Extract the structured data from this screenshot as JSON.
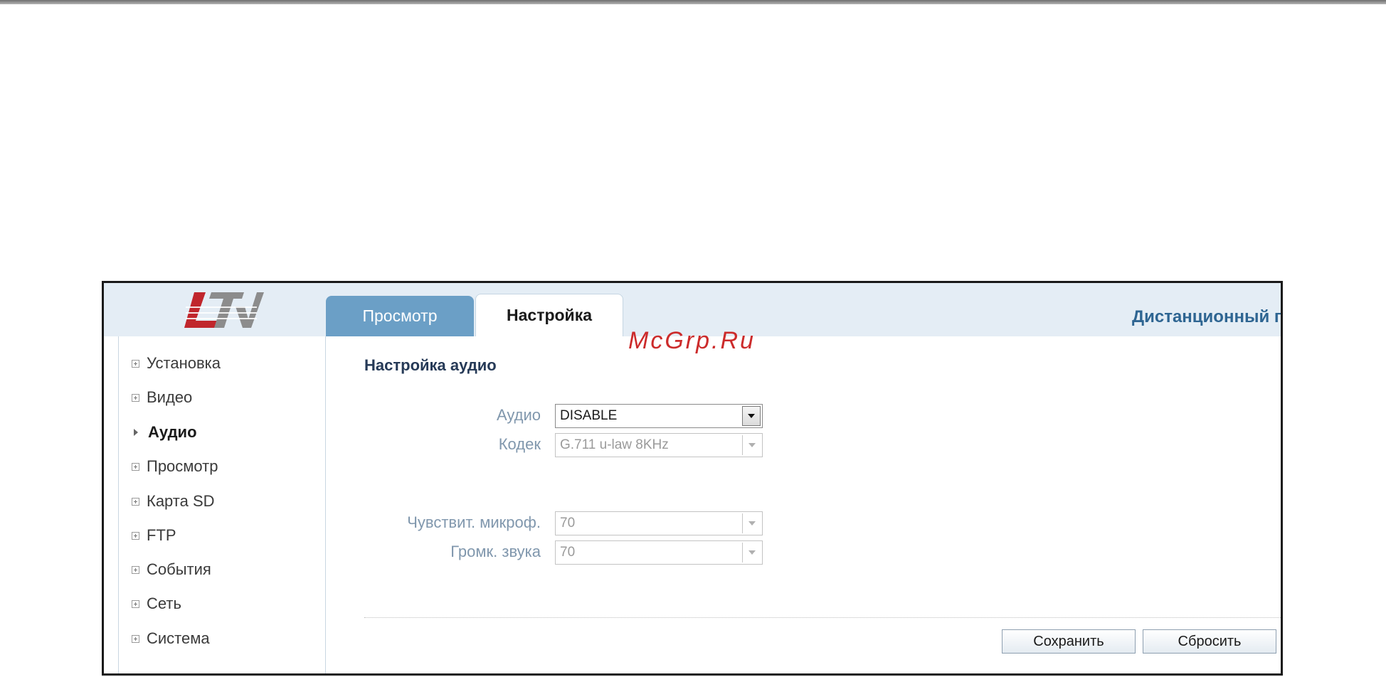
{
  "brand": {
    "logo_text": "LTV",
    "logo_color": "#c0262c"
  },
  "header": {
    "tabs": [
      {
        "label": "Просмотр",
        "active": false
      },
      {
        "label": "Настройка",
        "active": true
      }
    ],
    "title": "Дистанционный г"
  },
  "sidebar": {
    "items": [
      {
        "label": "Установка",
        "icon": "plus-box-icon",
        "active": false
      },
      {
        "label": "Видео",
        "icon": "plus-box-icon",
        "active": false
      },
      {
        "label": "Аудио",
        "icon": "arrow-right-icon",
        "active": true
      },
      {
        "label": "Просмотр",
        "icon": "plus-box-icon",
        "active": false
      },
      {
        "label": "Карта SD",
        "icon": "plus-box-icon",
        "active": false
      },
      {
        "label": "FTP",
        "icon": "plus-box-icon",
        "active": false
      },
      {
        "label": "События",
        "icon": "plus-box-icon",
        "active": false
      },
      {
        "label": "Сеть",
        "icon": "plus-box-icon",
        "active": false
      },
      {
        "label": "Система",
        "icon": "plus-box-icon",
        "active": false
      }
    ]
  },
  "main": {
    "section_title": "Настройка аудио",
    "fields": {
      "audio": {
        "label": "Аудио",
        "value": "DISABLE",
        "enabled": true
      },
      "codec": {
        "label": "Кодек",
        "value": "G.711 u-law 8KHz",
        "enabled": false
      },
      "mic_sensitivity": {
        "label": "Чувствит. микроф.",
        "value": "70",
        "enabled": false
      },
      "volume": {
        "label": "Громк. звука",
        "value": "70",
        "enabled": false
      }
    },
    "buttons": {
      "save": "Сохранить",
      "reset": "Сбросить"
    }
  },
  "watermark": "McGrp.Ru",
  "colors": {
    "header_band": "#e4edf5",
    "tab_inactive": "#6b9fc6",
    "title_blue": "#2e6592",
    "label_blue_gray": "#8097ad",
    "watermark_red": "#cc2b2b"
  }
}
